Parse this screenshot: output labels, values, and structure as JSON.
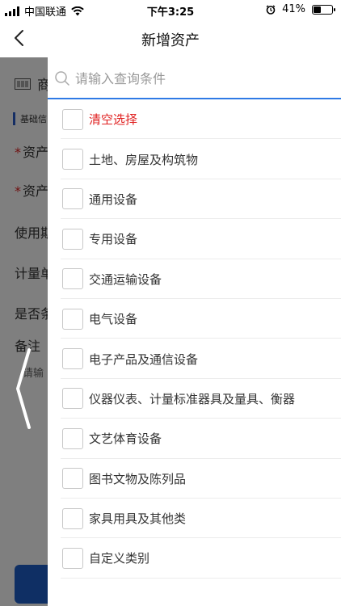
{
  "status_bar": {
    "carrier": "中国联通",
    "time": "下午3:25",
    "battery_percent": "41%",
    "battery_level": 0.41
  },
  "nav": {
    "title": "新增资产"
  },
  "background_form": {
    "header": "商",
    "section": "基础信",
    "rows": [
      {
        "label": "资产",
        "required": true
      },
      {
        "label": "资产",
        "required": true
      },
      {
        "label": "使用期",
        "required": false
      },
      {
        "label": "计量单",
        "required": false
      },
      {
        "label": "是否条",
        "required": false
      },
      {
        "label": "备注",
        "required": false
      }
    ],
    "hint": "请输"
  },
  "drawer": {
    "search_placeholder": "请输入查询条件",
    "items": [
      {
        "label": "清空选择",
        "checked": false
      },
      {
        "label": "土地、房屋及构筑物",
        "checked": false
      },
      {
        "label": "通用设备",
        "checked": false
      },
      {
        "label": "专用设备",
        "checked": false
      },
      {
        "label": "交通运输设备",
        "checked": false
      },
      {
        "label": "电气设备",
        "checked": false
      },
      {
        "label": "电子产品及通信设备",
        "checked": false
      },
      {
        "label": "仪器仪表、计量标准器具及量具、衡器",
        "checked": false
      },
      {
        "label": "文艺体育设备",
        "checked": false
      },
      {
        "label": "图书文物及陈列品",
        "checked": false
      },
      {
        "label": "家具用具及其他类",
        "checked": false
      },
      {
        "label": "自定义类别",
        "checked": false
      }
    ]
  },
  "colors": {
    "accent_blue": "#2f7ae5",
    "clear_red": "#e02020",
    "overlay": "rgba(0,0,0,0.5)"
  }
}
